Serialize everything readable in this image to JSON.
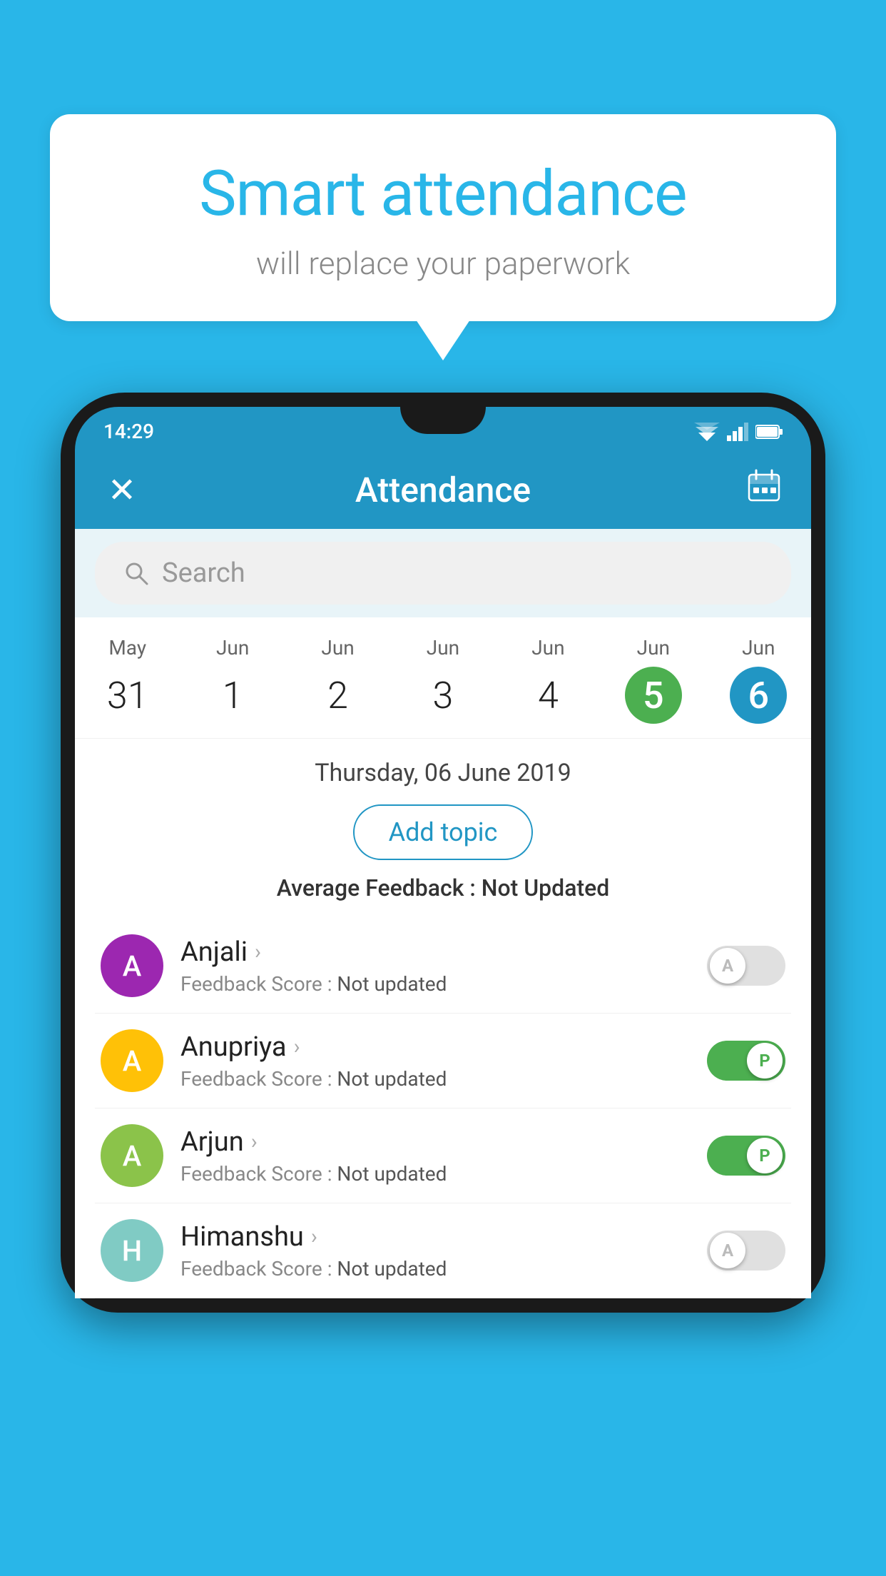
{
  "background_color": "#29b6e8",
  "speech_bubble": {
    "title": "Smart attendance",
    "subtitle": "will replace your paperwork"
  },
  "phone": {
    "status_bar": {
      "time": "14:29"
    },
    "app_bar": {
      "close_icon": "✕",
      "title": "Attendance",
      "calendar_icon": "📅"
    },
    "search": {
      "placeholder": "Search"
    },
    "calendar": {
      "days": [
        {
          "month": "May",
          "date": "31",
          "state": "normal"
        },
        {
          "month": "Jun",
          "date": "1",
          "state": "normal"
        },
        {
          "month": "Jun",
          "date": "2",
          "state": "normal"
        },
        {
          "month": "Jun",
          "date": "3",
          "state": "normal"
        },
        {
          "month": "Jun",
          "date": "4",
          "state": "normal"
        },
        {
          "month": "Jun",
          "date": "5",
          "state": "today"
        },
        {
          "month": "Jun",
          "date": "6",
          "state": "selected"
        }
      ]
    },
    "selected_date": "Thursday, 06 June 2019",
    "add_topic_label": "Add topic",
    "avg_feedback_label": "Average Feedback :",
    "avg_feedback_value": "Not Updated",
    "students": [
      {
        "name": "Anjali",
        "avatar_letter": "A",
        "avatar_color": "purple",
        "feedback_label": "Feedback Score :",
        "feedback_value": "Not updated",
        "toggle_state": "off",
        "toggle_letter": "A"
      },
      {
        "name": "Anupriya",
        "avatar_letter": "A",
        "avatar_color": "amber",
        "feedback_label": "Feedback Score :",
        "feedback_value": "Not updated",
        "toggle_state": "on-p",
        "toggle_letter": "P"
      },
      {
        "name": "Arjun",
        "avatar_letter": "A",
        "avatar_color": "green",
        "feedback_label": "Feedback Score :",
        "feedback_value": "Not updated",
        "toggle_state": "on-p",
        "toggle_letter": "P"
      },
      {
        "name": "Himanshu",
        "avatar_letter": "H",
        "avatar_color": "teal",
        "feedback_label": "Feedback Score :",
        "feedback_value": "Not updated",
        "toggle_state": "off",
        "toggle_letter": "A"
      }
    ]
  }
}
